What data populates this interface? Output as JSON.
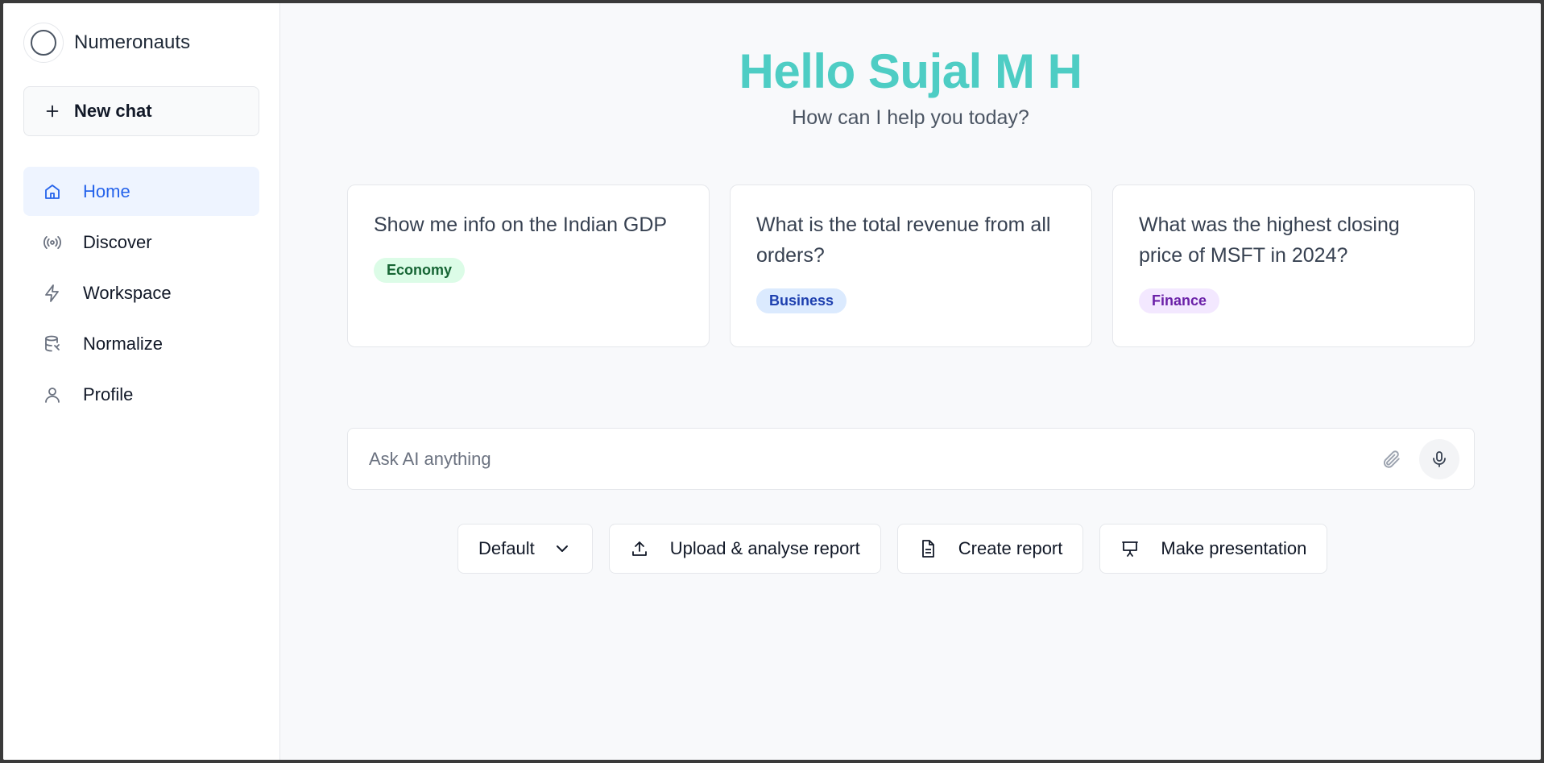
{
  "brand": {
    "name": "Numeronauts"
  },
  "sidebar": {
    "new_chat_label": "New chat",
    "items": [
      {
        "label": "Home",
        "icon": "home-icon",
        "active": true
      },
      {
        "label": "Discover",
        "icon": "broadcast-icon",
        "active": false
      },
      {
        "label": "Workspace",
        "icon": "lightning-icon",
        "active": false
      },
      {
        "label": "Normalize",
        "icon": "database-icon",
        "active": false
      },
      {
        "label": "Profile",
        "icon": "user-icon",
        "active": false
      }
    ]
  },
  "main": {
    "greeting": "Hello Sujal M H",
    "subtitle": "How can I help you today?",
    "cards": [
      {
        "question": "Show me info on the Indian GDP",
        "tag": "Economy"
      },
      {
        "question": "What is the total revenue from all orders?",
        "tag": "Business"
      },
      {
        "question": "What was the highest closing price of MSFT in 2024?",
        "tag": "Finance"
      }
    ],
    "ask": {
      "placeholder": "Ask AI anything",
      "value": ""
    },
    "actions": {
      "mode": "Default",
      "upload": "Upload & analyse report",
      "create": "Create report",
      "presentation": "Make presentation"
    }
  },
  "colors": {
    "accent": "#4ecdc4",
    "active_nav": "#2563eb",
    "active_nav_bg": "#eef4ff"
  }
}
